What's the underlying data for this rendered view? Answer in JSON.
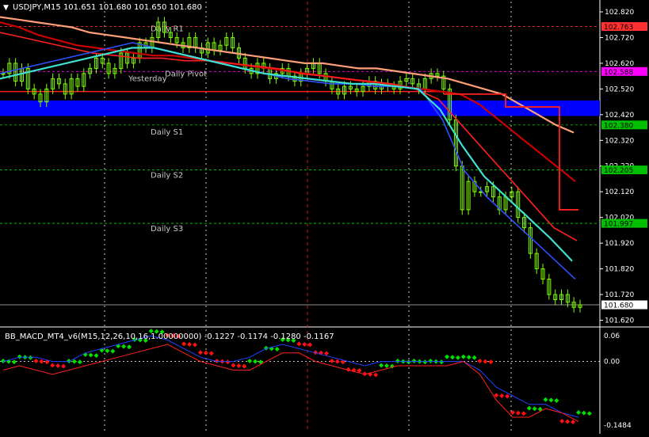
{
  "chart_data": [
    {
      "type": "candlestick",
      "title": "USDJPY,M15  101.651 101.680 101.650 101.680",
      "symbol": "USDJPY",
      "timeframe": "M15",
      "ohlc_header": {
        "open": 101.651,
        "high": 101.68,
        "low": 101.65,
        "close": 101.68
      },
      "ylim": [
        101.6,
        102.86
      ],
      "ytick_labels": [
        "102.820",
        "102.720",
        "102.620",
        "102.520",
        "102.420",
        "102.320",
        "102.220",
        "102.120",
        "102.020",
        "101.920",
        "101.820",
        "101.720",
        "101.620"
      ],
      "current_price": {
        "value": 101.68,
        "label": "101.680",
        "color": "#ffffff"
      },
      "pivot_levels": [
        {
          "name": "Daily R1",
          "value": 102.763,
          "label": "102.763",
          "color": "#ff3030",
          "style": "dashed"
        },
        {
          "name": "Daily Pivot",
          "value": 102.588,
          "label": "102.588",
          "color": "#ff00ff",
          "style": "dashed"
        },
        {
          "name": "Daily S1",
          "value": 102.38,
          "label": "102.380",
          "color": "#00c000",
          "style": "dashed"
        },
        {
          "name": "Daily S2",
          "value": 102.205,
          "label": "102.205",
          "color": "#00c000",
          "style": "dashed"
        },
        {
          "name": "Daily S3",
          "value": 101.997,
          "label": "101.997",
          "color": "#00c000",
          "style": "dashed"
        }
      ],
      "level_label_left": "Yesterday",
      "blue_zone": {
        "from": 102.415,
        "to": 102.475,
        "color": "#0000ff"
      },
      "red_horizontal": {
        "value": 102.51,
        "color": "#ff2020"
      },
      "candle_color": "#7fff00",
      "close_series": [
        102.58,
        102.62,
        102.55,
        102.6,
        102.52,
        102.5,
        102.47,
        102.52,
        102.56,
        102.54,
        102.5,
        102.56,
        102.53,
        102.58,
        102.6,
        102.64,
        102.62,
        102.58,
        102.6,
        102.66,
        102.62,
        102.64,
        102.7,
        102.68,
        102.72,
        102.78,
        102.74,
        102.72,
        102.7,
        102.68,
        102.72,
        102.68,
        102.66,
        102.7,
        102.67,
        102.69,
        102.72,
        102.68,
        102.64,
        102.6,
        102.58,
        102.62,
        102.6,
        102.56,
        102.58,
        102.6,
        102.57,
        102.55,
        102.58,
        102.6,
        102.62,
        102.58,
        102.55,
        102.52,
        102.5,
        102.53,
        102.52,
        102.51,
        102.53,
        102.55,
        102.52,
        102.54,
        102.53,
        102.52,
        102.55,
        102.56,
        102.54,
        102.52,
        102.56,
        102.58,
        102.57,
        102.52,
        102.4,
        102.22,
        102.05,
        102.16,
        102.12,
        102.12,
        102.14,
        102.1,
        102.05,
        102.1,
        102.12,
        102.02,
        101.98,
        101.88,
        101.82,
        101.78,
        101.72,
        101.7,
        101.72,
        101.69,
        101.67,
        101.68
      ],
      "moving_averages": [
        {
          "name": "MA slow",
          "color": "#ffa07a",
          "values": [
            102.8,
            102.79,
            102.78,
            102.77,
            102.76,
            102.74,
            102.73,
            102.72,
            102.71,
            102.7,
            102.69,
            102.68,
            102.67,
            102.66,
            102.65,
            102.64,
            102.63,
            102.62,
            102.62,
            102.61,
            102.6,
            102.6,
            102.59,
            102.58,
            102.57,
            102.56,
            102.54,
            102.52,
            102.5,
            102.46,
            102.42,
            102.38,
            102.35
          ]
        },
        {
          "name": "MA mid",
          "color": "#cc0000",
          "values": [
            102.78,
            102.76,
            102.73,
            102.71,
            102.69,
            102.68,
            102.67,
            102.66,
            102.65,
            102.65,
            102.64,
            102.63,
            102.62,
            102.61,
            102.6,
            102.59,
            102.58,
            102.57,
            102.56,
            102.55,
            102.54,
            102.53,
            102.52,
            102.51,
            102.5,
            102.46,
            102.4,
            102.34,
            102.28,
            102.22,
            102.16
          ]
        },
        {
          "name": "MA thin",
          "color": "#ff2020",
          "values": [
            102.74,
            102.72,
            102.7,
            102.68,
            102.66,
            102.65,
            102.64,
            102.64,
            102.63,
            102.63,
            102.62,
            102.61,
            102.6,
            102.58,
            102.57,
            102.56,
            102.55,
            102.54,
            102.52,
            102.48,
            102.38,
            102.28,
            102.18,
            102.08,
            101.98,
            101.93
          ]
        },
        {
          "name": "EMA fast",
          "color": "#3050ff",
          "values": [
            102.58,
            102.6,
            102.62,
            102.64,
            102.66,
            102.68,
            102.7,
            102.68,
            102.66,
            102.64,
            102.62,
            102.6,
            102.58,
            102.56,
            102.55,
            102.54,
            102.54,
            102.53,
            102.53,
            102.52,
            102.4,
            102.2,
            102.1,
            102.02,
            101.94,
            101.86,
            101.78
          ]
        },
        {
          "name": "EMA mid",
          "color": "#40e0d0",
          "values": [
            102.56,
            102.58,
            102.6,
            102.62,
            102.64,
            102.66,
            102.68,
            102.68,
            102.66,
            102.64,
            102.62,
            102.6,
            102.58,
            102.57,
            102.56,
            102.55,
            102.54,
            102.54,
            102.53,
            102.52,
            102.44,
            102.3,
            102.18,
            102.1,
            102.02,
            101.94,
            101.85
          ]
        }
      ],
      "step_line": {
        "color": "#ff2020",
        "values": [
          102.5,
          102.5,
          102.45,
          102.45,
          102.45,
          102.45,
          102.05,
          102.05
        ]
      }
    },
    {
      "type": "line",
      "title": "BB_MACD_MT4_v6(M15,12,26,10,16,1.00000000) -0.1227 -0.1174 -0.1280 -0.1167",
      "ylim": [
        -0.165,
        0.075
      ],
      "ytick_labels": [
        "0.06",
        "0.00",
        "-0.1484"
      ],
      "zero_line": 0.0,
      "series": [
        {
          "name": "MACD up dots",
          "color": "#00e000",
          "values": [
            0.0,
            0.01,
            0.0,
            -0.01,
            0.0,
            0.015,
            0.025,
            0.035,
            0.05,
            0.07,
            0.06,
            0.04,
            0.02,
            0.0,
            -0.01,
            0.0,
            0.03,
            0.05,
            0.04,
            0.02,
            0.0,
            -0.02,
            -0.03,
            -0.01,
            0.0,
            0.0,
            0.0,
            0.01,
            0.01,
            0.0,
            -0.08,
            -0.12,
            -0.11,
            -0.09,
            -0.14,
            -0.12
          ]
        },
        {
          "name": "Upper band",
          "color": "#2040ff",
          "values": [
            0.0,
            0.01,
            0.01,
            0.0,
            0.0,
            0.02,
            0.03,
            0.04,
            0.05,
            0.06,
            0.05,
            0.03,
            0.01,
            0.0,
            0.0,
            0.01,
            0.03,
            0.04,
            0.03,
            0.02,
            0.01,
            0.0,
            -0.01,
            0.0,
            0.0,
            0.0,
            0.0,
            0.0,
            0.0,
            -0.02,
            -0.06,
            -0.08,
            -0.1,
            -0.1,
            -0.12,
            -0.13
          ]
        },
        {
          "name": "Lower band",
          "color": "#ff2020",
          "values": [
            -0.02,
            -0.01,
            -0.02,
            -0.03,
            -0.02,
            -0.01,
            0.0,
            0.01,
            0.02,
            0.03,
            0.04,
            0.02,
            0.0,
            -0.01,
            -0.02,
            -0.02,
            0.0,
            0.02,
            0.02,
            0.0,
            -0.01,
            -0.02,
            -0.03,
            -0.02,
            -0.01,
            -0.01,
            -0.01,
            -0.01,
            0.0,
            -0.03,
            -0.09,
            -0.13,
            -0.13,
            -0.11,
            -0.12,
            -0.14
          ]
        }
      ]
    }
  ],
  "ui": {
    "symbol_arrow": "▼",
    "top_indicator_text": "",
    "colors": {
      "background": "#000000",
      "grid": "#ffffff",
      "axis_text": "#ffffff",
      "session_line": "#ff2020"
    }
  }
}
